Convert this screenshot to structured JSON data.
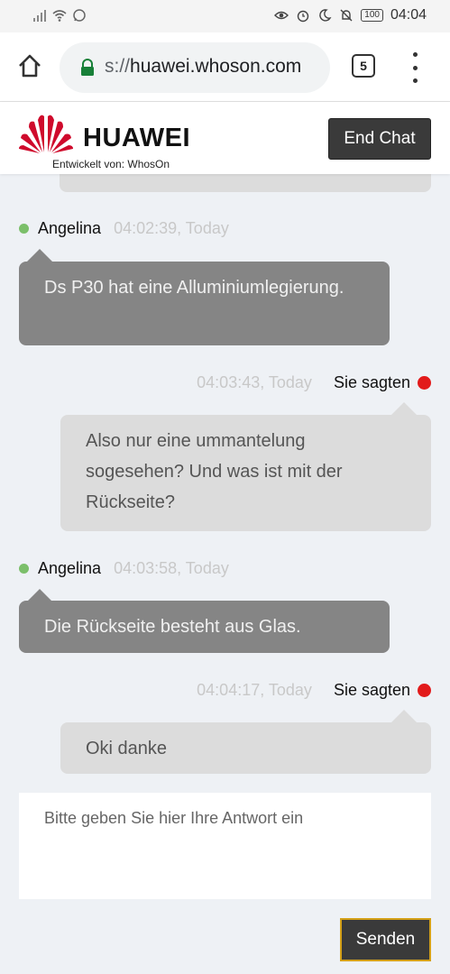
{
  "status_bar": {
    "time": "04:04",
    "battery": "100"
  },
  "browser": {
    "url_scheme": "s://",
    "url_host": "huawei.whoson.com",
    "tab_count": "5"
  },
  "header": {
    "brand": "HUAWEI",
    "developer_label": "Entwickelt von: WhosOn",
    "end_chat_label": "End Chat"
  },
  "messages": [
    {
      "sender": "Angelina",
      "time": "04:02:39, Today",
      "text": "Ds P30 hat eine Alluminiumlegierung."
    },
    {
      "sender": "Sie sagten",
      "time": "04:03:43, Today",
      "text": "Also nur eine ummantelung sogesehen? Und was ist mit der Rückseite?"
    },
    {
      "sender": "Angelina",
      "time": "04:03:58, Today",
      "text": "Die Rückseite besteht aus Glas."
    },
    {
      "sender": "Sie sagten",
      "time": "04:04:17, Today",
      "text": "Oki danke"
    }
  ],
  "reply": {
    "placeholder": "Bitte geben Sie hier Ihre Antwort ein"
  },
  "send_label": "Senden",
  "colors": {
    "agent_bubble": "#858585",
    "user_bubble": "#dcdcdc",
    "online_dot": "#7bbf6a",
    "user_dot": "#e21b1b",
    "brand_red": "#cf0a2c"
  }
}
